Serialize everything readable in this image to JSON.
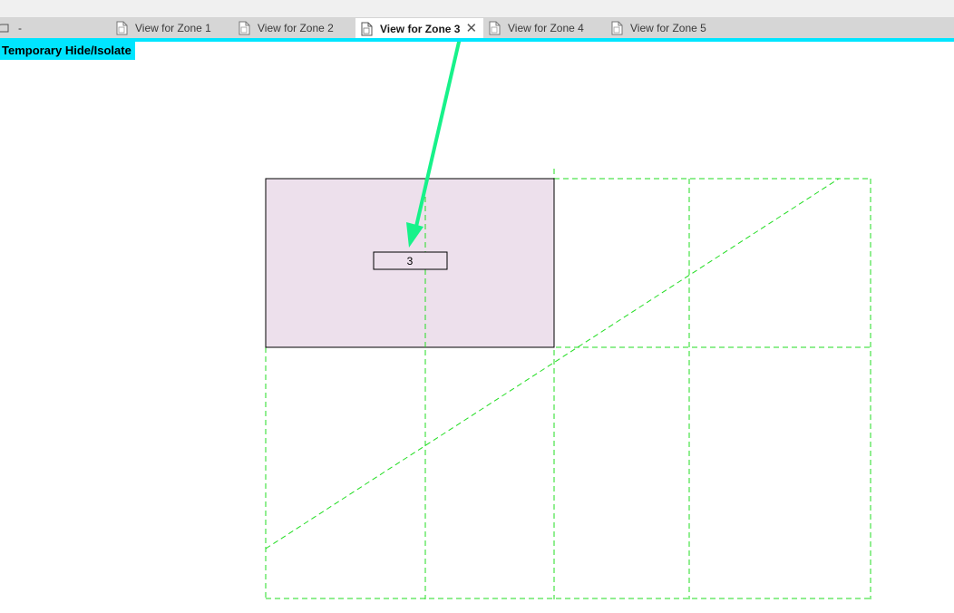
{
  "tabs": [
    {
      "label": "-",
      "active": false
    },
    {
      "label": "View for Zone 1",
      "active": false
    },
    {
      "label": "View for Zone 2",
      "active": false
    },
    {
      "label": "View for Zone 3",
      "active": true
    },
    {
      "label": "View for Zone 4",
      "active": false
    },
    {
      "label": "View for Zone 5",
      "active": false
    }
  ],
  "close_glyph": "✕",
  "mode_banner": "Temporary Hide/Isolate",
  "zone_tag": "3",
  "colors": {
    "accent": "#00e5ff",
    "zone_fill": "#ede0ec",
    "guide_lines": "#22dd22",
    "arrow": "#17f28a"
  },
  "icons": {
    "tab_icon": "document-icon",
    "first_tab_icon": "cloud-icon",
    "close": "close-icon",
    "arrow": "arrow-annotation"
  }
}
